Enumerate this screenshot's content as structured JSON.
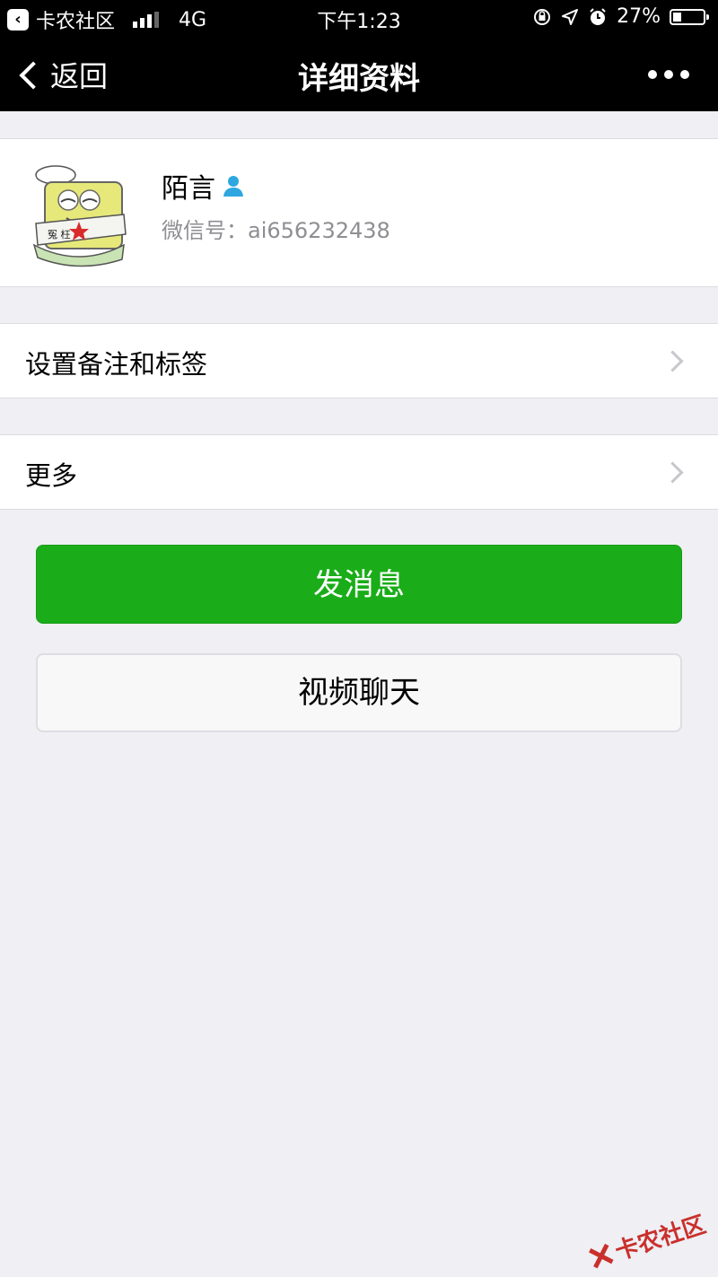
{
  "status_bar": {
    "carrier_app": "卡农社区",
    "network": "4G",
    "time": "下午1:23",
    "battery": "27%",
    "battery_level": 0.27
  },
  "nav": {
    "back_label": "返回",
    "title": "详细资料"
  },
  "profile": {
    "name": "陌言",
    "wechat_id": "微信号：ai656232438",
    "avatar_text": "冤 枉"
  },
  "cells": {
    "remark_label": "设置备注和标签",
    "more_label": "更多"
  },
  "buttons": {
    "send_message": "发消息",
    "video_chat": "视频聊天"
  },
  "watermark": "卡农社区",
  "colors": {
    "primary_green": "#1aad19",
    "nav_bg": "#000000",
    "page_bg": "#efeff4",
    "gender_icon": "#2ea7e0"
  }
}
